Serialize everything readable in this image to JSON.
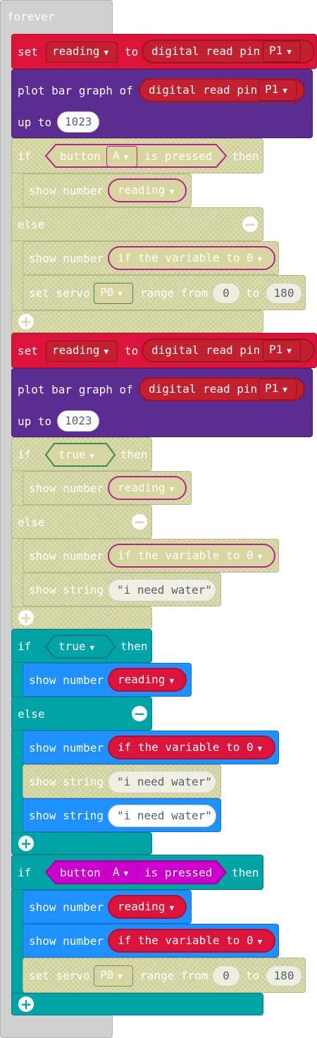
{
  "forever": {
    "label": "forever"
  },
  "b1": {
    "set": {
      "label": "set",
      "var": "reading",
      "to": "to",
      "fn": "digital read pin",
      "pin": "P1"
    },
    "plot": {
      "label": "plot bar graph of",
      "fn": "digital read pin",
      "pin": "P1",
      "upto": "up to",
      "max": "1023"
    },
    "if": {
      "if": "if",
      "cond_a": "button",
      "cond_btn": "A",
      "cond_b": "is pressed",
      "then": "then",
      "show1": "show number",
      "show1_val": "reading",
      "else": "else",
      "show2": "show number",
      "show2_val": "if the variable to 0",
      "servo": "set servo",
      "servo_pin": "P0",
      "range": "range from",
      "from": "0",
      "to": "to",
      "to_val": "180"
    }
  },
  "b2": {
    "set": {
      "label": "set",
      "var": "reading",
      "to": "to",
      "fn": "digital read pin",
      "pin": "P1"
    },
    "plot": {
      "label": "plot bar graph of",
      "fn": "digital read pin",
      "pin": "P1",
      "upto": "up to",
      "max": "1023"
    },
    "if": {
      "if": "if",
      "cond": "true",
      "then": "then",
      "show1": "show number",
      "show1_val": "reading",
      "else": "else",
      "show2": "show number",
      "show2_val": "if the variable to 0",
      "str": "show string",
      "str_val": "\"i need water\""
    }
  },
  "b3": {
    "if": {
      "if": "if",
      "cond": "true",
      "then": "then",
      "show1": "show number",
      "show1_val": "reading",
      "else": "else",
      "show2": "show number",
      "show2_val": "if the variable to 0",
      "str1": "show string",
      "str1_val": "\"i need water\"",
      "str2": "show string",
      "str2_val": "\"i need water\""
    }
  },
  "b4": {
    "if": {
      "if": "if",
      "cond_a": "button",
      "cond_btn": "A",
      "cond_b": "is pressed",
      "then": "then",
      "show1": "show number",
      "show1_val": "reading",
      "show2": "show number",
      "show2_val": "if the variable to 0",
      "servo": "set servo",
      "servo_pin": "P0",
      "range": "range from",
      "from": "0",
      "to": "to",
      "to_val": "180"
    }
  },
  "icons": {
    "dropdown": "caret-down-icon",
    "minus": "minus-circle-icon",
    "plus": "plus-circle-icon"
  },
  "colors": {
    "set": "#dc143c",
    "plot": "#5b2c91",
    "if": "#00a4a6",
    "show": "#1e90ff",
    "boolean": "#cc00cc",
    "forever": "#d0d0d0",
    "disabled": "#d7d5a0"
  }
}
